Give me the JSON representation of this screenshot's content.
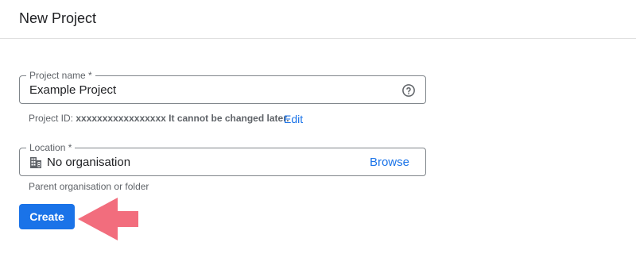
{
  "header": {
    "title": "New Project"
  },
  "project_name": {
    "label": "Project name *",
    "value": "Example Project",
    "help_icon": "help-circle-icon"
  },
  "project_id_hint": {
    "prefix": "Project ID:",
    "id_value": "xxxxxxxxxxxxxxxxx",
    "suffix": "It cannot be changed later.",
    "edit_label": "Edit"
  },
  "location": {
    "label": "Location *",
    "icon": "building-icon",
    "value": "No organisation",
    "browse_label": "Browse",
    "hint": "Parent organisation or folder"
  },
  "actions": {
    "create_label": "Create"
  },
  "annotation": {
    "arrow_icon": "pointer-arrow-icon",
    "arrow_color": "#f26d7d"
  },
  "colors": {
    "accent": "#1a73e8",
    "border": "#80868b",
    "muted_text": "#5f6368"
  }
}
